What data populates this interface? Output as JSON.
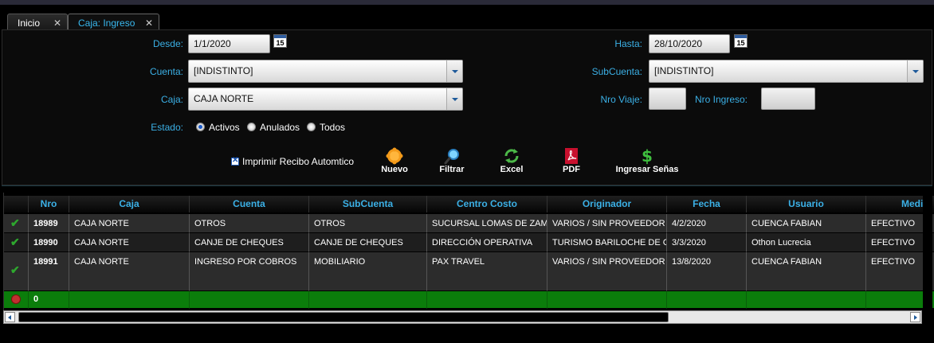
{
  "tabs": [
    {
      "label": "Inicio",
      "close": "✕"
    },
    {
      "label": "Caja: Ingreso",
      "close": "✕"
    }
  ],
  "filters": {
    "desde_label": "Desde:",
    "desde_value": "1/1/2020",
    "hasta_label": "Hasta:",
    "hasta_value": "28/10/2020",
    "calendar_day": "15",
    "cuenta_label": "Cuenta:",
    "cuenta_value": "[INDISTINTO]",
    "subcuenta_label": "SubCuenta:",
    "subcuenta_value": "[INDISTINTO]",
    "caja_label": "Caja:",
    "caja_value": "CAJA NORTE",
    "nro_viaje_label": "Nro Viaje:",
    "nro_ingreso_label": "Nro Ingreso:",
    "estado_label": "Estado:",
    "estado_options": [
      "Activos",
      "Anulados",
      "Todos"
    ],
    "estado_selected": "Activos"
  },
  "toolbar": {
    "imprimir_label": "Imprimir Recibo Automtico",
    "imprimir_checked": true,
    "nuevo": "Nuevo",
    "filtrar": "Filtrar",
    "excel": "Excel",
    "pdf": "PDF",
    "ingresar_senas": "Ingresar Señas"
  },
  "table": {
    "columns": [
      "Nro",
      "Caja",
      "Cuenta",
      "SubCuenta",
      "Centro Costo",
      "Originador",
      "Fecha",
      "Usuario",
      "Medi"
    ],
    "rows": [
      {
        "status": "active",
        "cells": [
          "18989",
          "CAJA NORTE",
          "OTROS",
          "OTROS",
          "SUCURSAL LOMAS DE ZAMC",
          "VARIOS / SIN PROVEEDOR I",
          "4/2/2020",
          "CUENCA FABIAN",
          "EFECTIVO"
        ]
      },
      {
        "status": "active",
        "cells": [
          "18990",
          "CAJA NORTE",
          "CANJE DE CHEQUES",
          "CANJE DE CHEQUES",
          "DIRECCIÓN OPERATIVA",
          "TURISMO BARILOCHE DE C/",
          "3/3/2020",
          "Othon Lucrecia",
          "EFECTIVO"
        ]
      },
      {
        "status": "active",
        "cells": [
          "18991",
          "CAJA NORTE",
          "INGRESO POR COBROS",
          "MOBILIARIO",
          "PAX TRAVEL",
          "VARIOS / SIN PROVEEDOR I",
          "13/8/2020",
          "CUENCA FABIAN",
          "EFECTIVO"
        ]
      }
    ],
    "total_row": {
      "status": "new",
      "cells": [
        "0",
        "",
        "",
        "",
        "",
        "",
        "",
        "",
        ""
      ]
    }
  },
  "colors": {
    "accent": "#3bb0e6",
    "total_row": "#0b7d0b",
    "check": "#2ea82e"
  },
  "icons": {
    "nuevo": "sun-gear-icon",
    "filtrar": "magnifier-icon",
    "excel": "refresh-icon",
    "pdf": "pdf-icon",
    "ingresar_senas": "dollar-icon",
    "row_ok": "checkmark-icon",
    "row_new": "stop-icon"
  }
}
